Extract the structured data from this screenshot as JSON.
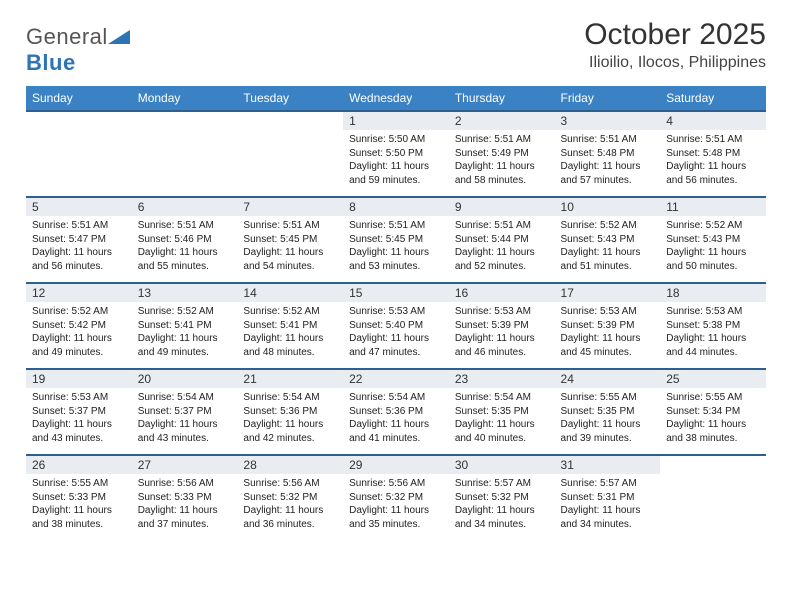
{
  "logo": {
    "general": "General",
    "blue": "Blue"
  },
  "title": "October 2025",
  "subtitle": "Ilioilio, Ilocos, Philippines",
  "weekdays": [
    "Sunday",
    "Monday",
    "Tuesday",
    "Wednesday",
    "Thursday",
    "Friday",
    "Saturday"
  ],
  "weeks": [
    [
      {
        "n": "",
        "sr": "",
        "ss": "",
        "dl": ""
      },
      {
        "n": "",
        "sr": "",
        "ss": "",
        "dl": ""
      },
      {
        "n": "",
        "sr": "",
        "ss": "",
        "dl": ""
      },
      {
        "n": "1",
        "sr": "Sunrise: 5:50 AM",
        "ss": "Sunset: 5:50 PM",
        "dl": "Daylight: 11 hours and 59 minutes."
      },
      {
        "n": "2",
        "sr": "Sunrise: 5:51 AM",
        "ss": "Sunset: 5:49 PM",
        "dl": "Daylight: 11 hours and 58 minutes."
      },
      {
        "n": "3",
        "sr": "Sunrise: 5:51 AM",
        "ss": "Sunset: 5:48 PM",
        "dl": "Daylight: 11 hours and 57 minutes."
      },
      {
        "n": "4",
        "sr": "Sunrise: 5:51 AM",
        "ss": "Sunset: 5:48 PM",
        "dl": "Daylight: 11 hours and 56 minutes."
      }
    ],
    [
      {
        "n": "5",
        "sr": "Sunrise: 5:51 AM",
        "ss": "Sunset: 5:47 PM",
        "dl": "Daylight: 11 hours and 56 minutes."
      },
      {
        "n": "6",
        "sr": "Sunrise: 5:51 AM",
        "ss": "Sunset: 5:46 PM",
        "dl": "Daylight: 11 hours and 55 minutes."
      },
      {
        "n": "7",
        "sr": "Sunrise: 5:51 AM",
        "ss": "Sunset: 5:45 PM",
        "dl": "Daylight: 11 hours and 54 minutes."
      },
      {
        "n": "8",
        "sr": "Sunrise: 5:51 AM",
        "ss": "Sunset: 5:45 PM",
        "dl": "Daylight: 11 hours and 53 minutes."
      },
      {
        "n": "9",
        "sr": "Sunrise: 5:51 AM",
        "ss": "Sunset: 5:44 PM",
        "dl": "Daylight: 11 hours and 52 minutes."
      },
      {
        "n": "10",
        "sr": "Sunrise: 5:52 AM",
        "ss": "Sunset: 5:43 PM",
        "dl": "Daylight: 11 hours and 51 minutes."
      },
      {
        "n": "11",
        "sr": "Sunrise: 5:52 AM",
        "ss": "Sunset: 5:43 PM",
        "dl": "Daylight: 11 hours and 50 minutes."
      }
    ],
    [
      {
        "n": "12",
        "sr": "Sunrise: 5:52 AM",
        "ss": "Sunset: 5:42 PM",
        "dl": "Daylight: 11 hours and 49 minutes."
      },
      {
        "n": "13",
        "sr": "Sunrise: 5:52 AM",
        "ss": "Sunset: 5:41 PM",
        "dl": "Daylight: 11 hours and 49 minutes."
      },
      {
        "n": "14",
        "sr": "Sunrise: 5:52 AM",
        "ss": "Sunset: 5:41 PM",
        "dl": "Daylight: 11 hours and 48 minutes."
      },
      {
        "n": "15",
        "sr": "Sunrise: 5:53 AM",
        "ss": "Sunset: 5:40 PM",
        "dl": "Daylight: 11 hours and 47 minutes."
      },
      {
        "n": "16",
        "sr": "Sunrise: 5:53 AM",
        "ss": "Sunset: 5:39 PM",
        "dl": "Daylight: 11 hours and 46 minutes."
      },
      {
        "n": "17",
        "sr": "Sunrise: 5:53 AM",
        "ss": "Sunset: 5:39 PM",
        "dl": "Daylight: 11 hours and 45 minutes."
      },
      {
        "n": "18",
        "sr": "Sunrise: 5:53 AM",
        "ss": "Sunset: 5:38 PM",
        "dl": "Daylight: 11 hours and 44 minutes."
      }
    ],
    [
      {
        "n": "19",
        "sr": "Sunrise: 5:53 AM",
        "ss": "Sunset: 5:37 PM",
        "dl": "Daylight: 11 hours and 43 minutes."
      },
      {
        "n": "20",
        "sr": "Sunrise: 5:54 AM",
        "ss": "Sunset: 5:37 PM",
        "dl": "Daylight: 11 hours and 43 minutes."
      },
      {
        "n": "21",
        "sr": "Sunrise: 5:54 AM",
        "ss": "Sunset: 5:36 PM",
        "dl": "Daylight: 11 hours and 42 minutes."
      },
      {
        "n": "22",
        "sr": "Sunrise: 5:54 AM",
        "ss": "Sunset: 5:36 PM",
        "dl": "Daylight: 11 hours and 41 minutes."
      },
      {
        "n": "23",
        "sr": "Sunrise: 5:54 AM",
        "ss": "Sunset: 5:35 PM",
        "dl": "Daylight: 11 hours and 40 minutes."
      },
      {
        "n": "24",
        "sr": "Sunrise: 5:55 AM",
        "ss": "Sunset: 5:35 PM",
        "dl": "Daylight: 11 hours and 39 minutes."
      },
      {
        "n": "25",
        "sr": "Sunrise: 5:55 AM",
        "ss": "Sunset: 5:34 PM",
        "dl": "Daylight: 11 hours and 38 minutes."
      }
    ],
    [
      {
        "n": "26",
        "sr": "Sunrise: 5:55 AM",
        "ss": "Sunset: 5:33 PM",
        "dl": "Daylight: 11 hours and 38 minutes."
      },
      {
        "n": "27",
        "sr": "Sunrise: 5:56 AM",
        "ss": "Sunset: 5:33 PM",
        "dl": "Daylight: 11 hours and 37 minutes."
      },
      {
        "n": "28",
        "sr": "Sunrise: 5:56 AM",
        "ss": "Sunset: 5:32 PM",
        "dl": "Daylight: 11 hours and 36 minutes."
      },
      {
        "n": "29",
        "sr": "Sunrise: 5:56 AM",
        "ss": "Sunset: 5:32 PM",
        "dl": "Daylight: 11 hours and 35 minutes."
      },
      {
        "n": "30",
        "sr": "Sunrise: 5:57 AM",
        "ss": "Sunset: 5:32 PM",
        "dl": "Daylight: 11 hours and 34 minutes."
      },
      {
        "n": "31",
        "sr": "Sunrise: 5:57 AM",
        "ss": "Sunset: 5:31 PM",
        "dl": "Daylight: 11 hours and 34 minutes."
      },
      {
        "n": "",
        "sr": "",
        "ss": "",
        "dl": ""
      }
    ]
  ]
}
